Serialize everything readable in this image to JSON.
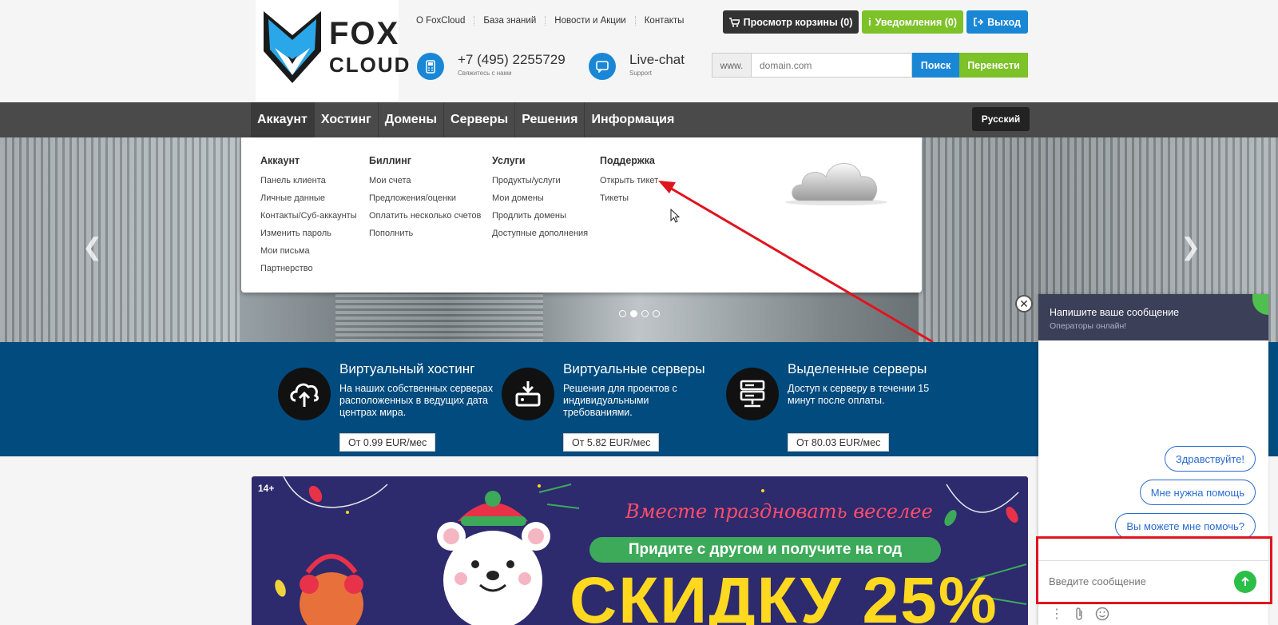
{
  "brand": {
    "line1": "FOX",
    "line2": "CLOUD"
  },
  "toplinks": [
    "О FoxCloud",
    "База знаний",
    "Новости и Акции",
    "Контакты"
  ],
  "buttons": {
    "cart": "Просмотр корзины (0)",
    "notifications": "Уведомления (0)",
    "logout": "Выход"
  },
  "contacts": {
    "phone": "+7 (495) 2255729",
    "phone_sub": "Свяжитесь с нами",
    "chat": "Live-chat",
    "chat_sub": "Support"
  },
  "domain": {
    "prefix": "www.",
    "placeholder": "domain.com",
    "search": "Поиск",
    "transfer": "Перенести"
  },
  "nav": [
    "Аккаунт",
    "Хостинг",
    "Домены",
    "Серверы",
    "Решения",
    "Информация"
  ],
  "language": "Русский",
  "dropdown": [
    {
      "heading": "Аккаунт",
      "links": [
        "Панель клиента",
        "Личные данные",
        "Контакты/Суб-аккаунты",
        "Изменить пароль",
        "Мои письма",
        "Партнерство"
      ]
    },
    {
      "heading": "Биллинг",
      "links": [
        "Мои счета",
        "Предложения/оценки",
        "Оплатить несколько счетов",
        "Пополнить"
      ]
    },
    {
      "heading": "Услуги",
      "links": [
        "Продукты/услуги",
        "Мои домены",
        "Продлить домены",
        "Доступные дополнения"
      ]
    },
    {
      "heading": "Поддержка",
      "links": [
        "Открыть тикет",
        "Тикеты"
      ]
    }
  ],
  "features": [
    {
      "title": "Виртуальный хостинг",
      "desc": "На наших собственных серверах расположенных в ведущих дата центрах мира.",
      "price": "От 0.99 EUR/мес",
      "icon": "cloud-upload-icon"
    },
    {
      "title": "Виртуальные серверы",
      "desc": "Решения для проектов с индивидуальными требованиями.",
      "price": "От 5.82 EUR/мес",
      "icon": "server-download-icon"
    },
    {
      "title": "Выделенные серверы",
      "desc": "Доступ к серверу в течении 15 минут после оплаты.",
      "price": "От 80.03 EUR/мес",
      "icon": "server-rack-icon"
    }
  ],
  "promo": {
    "age": "14+",
    "script": "Вместе праздновать веселее",
    "pill": "Придите с другом и получите на год",
    "big": "СКИДКУ 25%"
  },
  "chat": {
    "title": "Напишите ваше сообщение",
    "subtitle": "Операторы онлайн!",
    "quick_replies": [
      "Здравствуйте!",
      "Мне нужна помощь",
      "Вы можете мне помочь?"
    ],
    "placeholder": "Введите сообщение"
  },
  "colors": {
    "blue": "#1a87d6",
    "green": "#7cc228",
    "nav": "#4a4a4a",
    "band": "#024b7e",
    "chat_header": "#3b3f57",
    "annotation": "#e0141e"
  }
}
